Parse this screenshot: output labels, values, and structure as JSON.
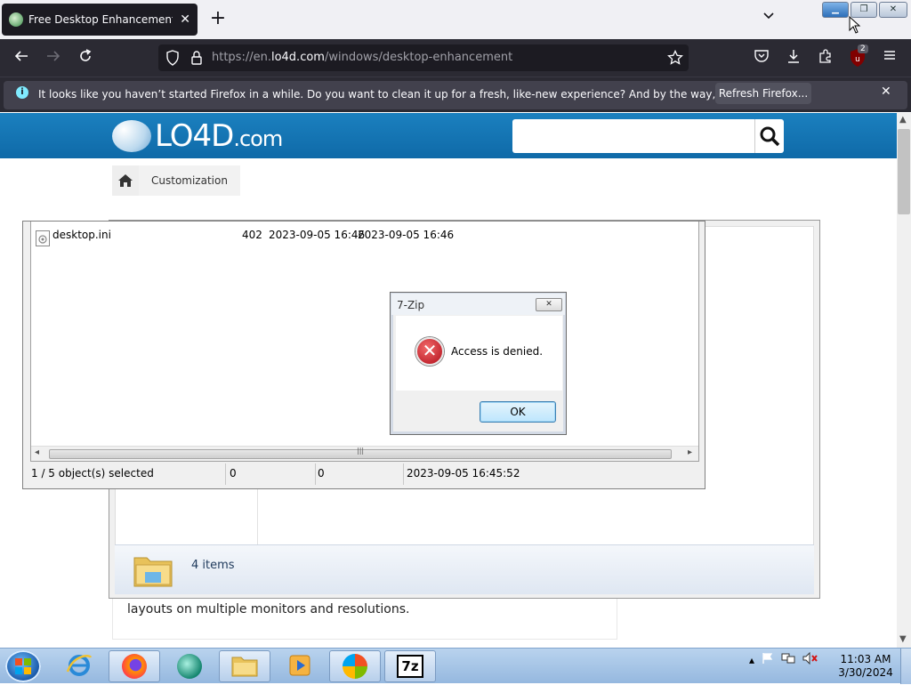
{
  "browser": {
    "tab_title": "Free Desktop Enhancement Sof",
    "tab_close": "✕",
    "new_tab": "+",
    "tab_list": "⌄",
    "url_prefix": "https://en.",
    "url_domain": "lo4d.com",
    "url_path": "/windows/desktop-enhancement",
    "extension_badge": "2"
  },
  "notification": {
    "icon": "i",
    "message": "It looks like you haven’t started Firefox in a while. Do you want to clean it up for a fresh, like-new experience? And by the way, welcome back!",
    "button": "Refresh Firefox...",
    "close": "✕"
  },
  "site": {
    "logo_main": "LO4D",
    "logo_suffix": ".com",
    "search_placeholder": "",
    "breadcrumb_category": "Customization"
  },
  "explorer": {
    "items_count": "4 items"
  },
  "paragraph": "layouts on multiple monitors and resolutions.",
  "zip_manager": {
    "file": {
      "name": "desktop.ini",
      "size": "402",
      "modified": "2023-09-05 16:46",
      "created": "2023-09-05 16:46"
    },
    "scroll_left": "◂",
    "scroll_right": "▸",
    "scroll_grip": "|||",
    "status": {
      "selected": "1 / 5 object(s) selected",
      "size": "0",
      "packed": "0",
      "date": "2023-09-05 16:45:52"
    }
  },
  "dialog": {
    "title": "7-Zip",
    "close": "✕",
    "message": "Access is denied.",
    "error_glyph": "✕",
    "ok": "OK"
  },
  "taskbar": {
    "clock_time": "11:03 AM",
    "clock_date": "3/30/2024",
    "tray_arrow": "▴",
    "zip_label": "7z"
  },
  "colors": {
    "firefox_dark": "#2b2a33",
    "banner_blue": "#1577b6",
    "error_red": "#c4141f"
  }
}
